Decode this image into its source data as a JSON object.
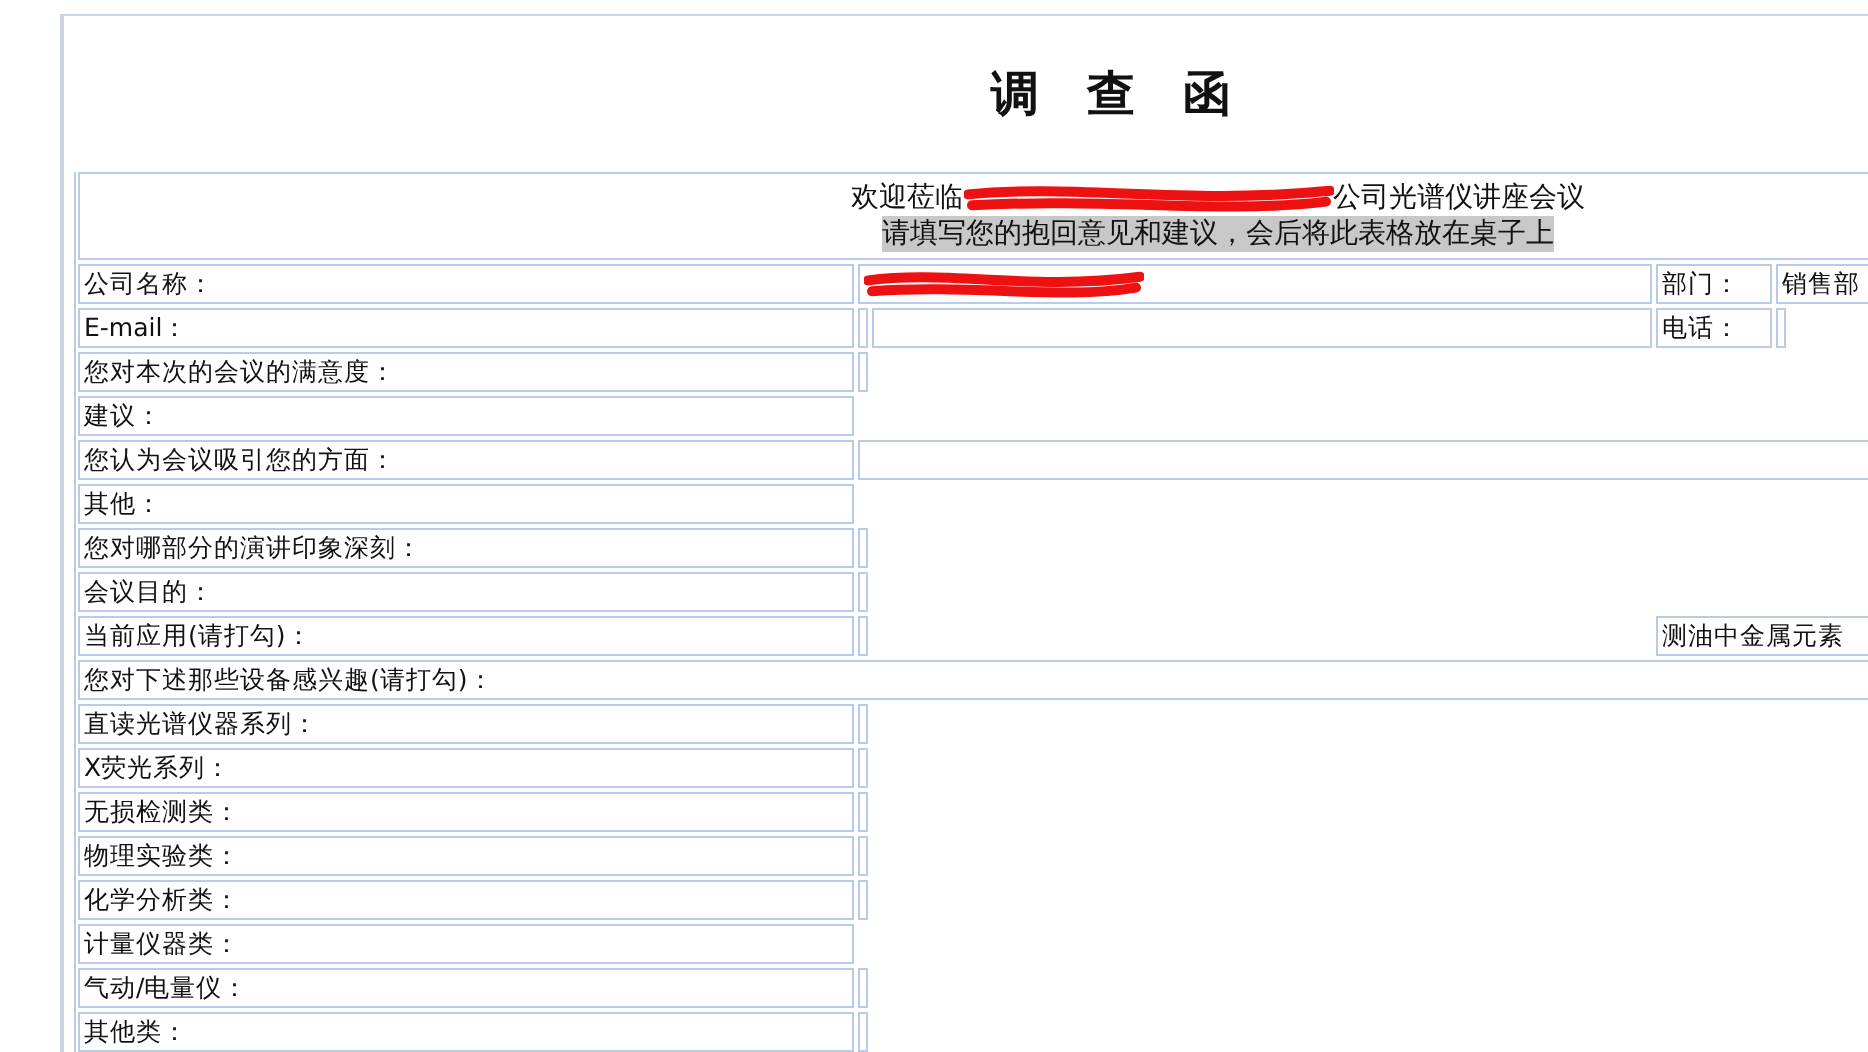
{
  "title": "调　查　函",
  "header": {
    "line_1_start": "欢迎莅临",
    "line_1_end": "公司光谱仪讲座会议",
    "line_2": "请填写您的抱回意见和建议，会后将此表格放在桌子上"
  },
  "rows": [
    {
      "cells": [
        {
          "kind": "label",
          "text": "公司名称："
        },
        {
          "kind": "redacted"
        },
        {
          "kind": "side-label",
          "text": "部门："
        },
        {
          "kind": "side-value",
          "text": "销售部"
        }
      ]
    },
    {
      "cells": [
        {
          "kind": "label",
          "text": "E-mail："
        },
        {
          "kind": "narrow"
        },
        {
          "kind": "value"
        },
        {
          "kind": "side-label",
          "text": "电话："
        },
        {
          "kind": "narrow"
        }
      ]
    },
    {
      "cells": [
        {
          "kind": "label",
          "text": "您对本次的会议的满意度："
        },
        {
          "kind": "narrow"
        }
      ]
    },
    {
      "cells": [
        {
          "kind": "label",
          "text": "建议："
        }
      ]
    },
    {
      "cells": [
        {
          "kind": "label",
          "text": "您认为会议吸引您的方面："
        },
        {
          "kind": "wide"
        }
      ]
    },
    {
      "cells": [
        {
          "kind": "label",
          "text": "其他："
        }
      ]
    },
    {
      "cells": [
        {
          "kind": "label",
          "text": "您对哪部分的演讲印象深刻："
        },
        {
          "kind": "narrow"
        }
      ]
    },
    {
      "cells": [
        {
          "kind": "label",
          "text": "会议目的："
        },
        {
          "kind": "narrow"
        }
      ]
    },
    {
      "cells": [
        {
          "kind": "label",
          "text": "当前应用(请打勾)："
        },
        {
          "kind": "narrow"
        },
        {
          "kind": "gap"
        },
        {
          "kind": "side-value",
          "text": "测油中金属元素"
        }
      ]
    },
    {
      "cells": [
        {
          "kind": "full",
          "text": "您对下述那些设备感兴趣(请打勾)："
        }
      ]
    },
    {
      "cells": [
        {
          "kind": "label",
          "text": "直读光谱仪器系列："
        },
        {
          "kind": "narrow"
        }
      ]
    },
    {
      "cells": [
        {
          "kind": "label",
          "text": "X荧光系列："
        },
        {
          "kind": "narrow"
        }
      ]
    },
    {
      "cells": [
        {
          "kind": "label",
          "text": "无损检测类："
        },
        {
          "kind": "narrow"
        }
      ]
    },
    {
      "cells": [
        {
          "kind": "label",
          "text": "物理实验类："
        },
        {
          "kind": "narrow"
        }
      ]
    },
    {
      "cells": [
        {
          "kind": "label",
          "text": "化学分析类："
        },
        {
          "kind": "narrow"
        }
      ]
    },
    {
      "cells": [
        {
          "kind": "label",
          "text": "计量仪器类："
        }
      ]
    },
    {
      "cells": [
        {
          "kind": "label",
          "text": "气动/电量仪："
        },
        {
          "kind": "narrow"
        }
      ]
    },
    {
      "cells": [
        {
          "kind": "label",
          "text": "其他类："
        },
        {
          "kind": "narrow"
        }
      ]
    }
  ]
}
